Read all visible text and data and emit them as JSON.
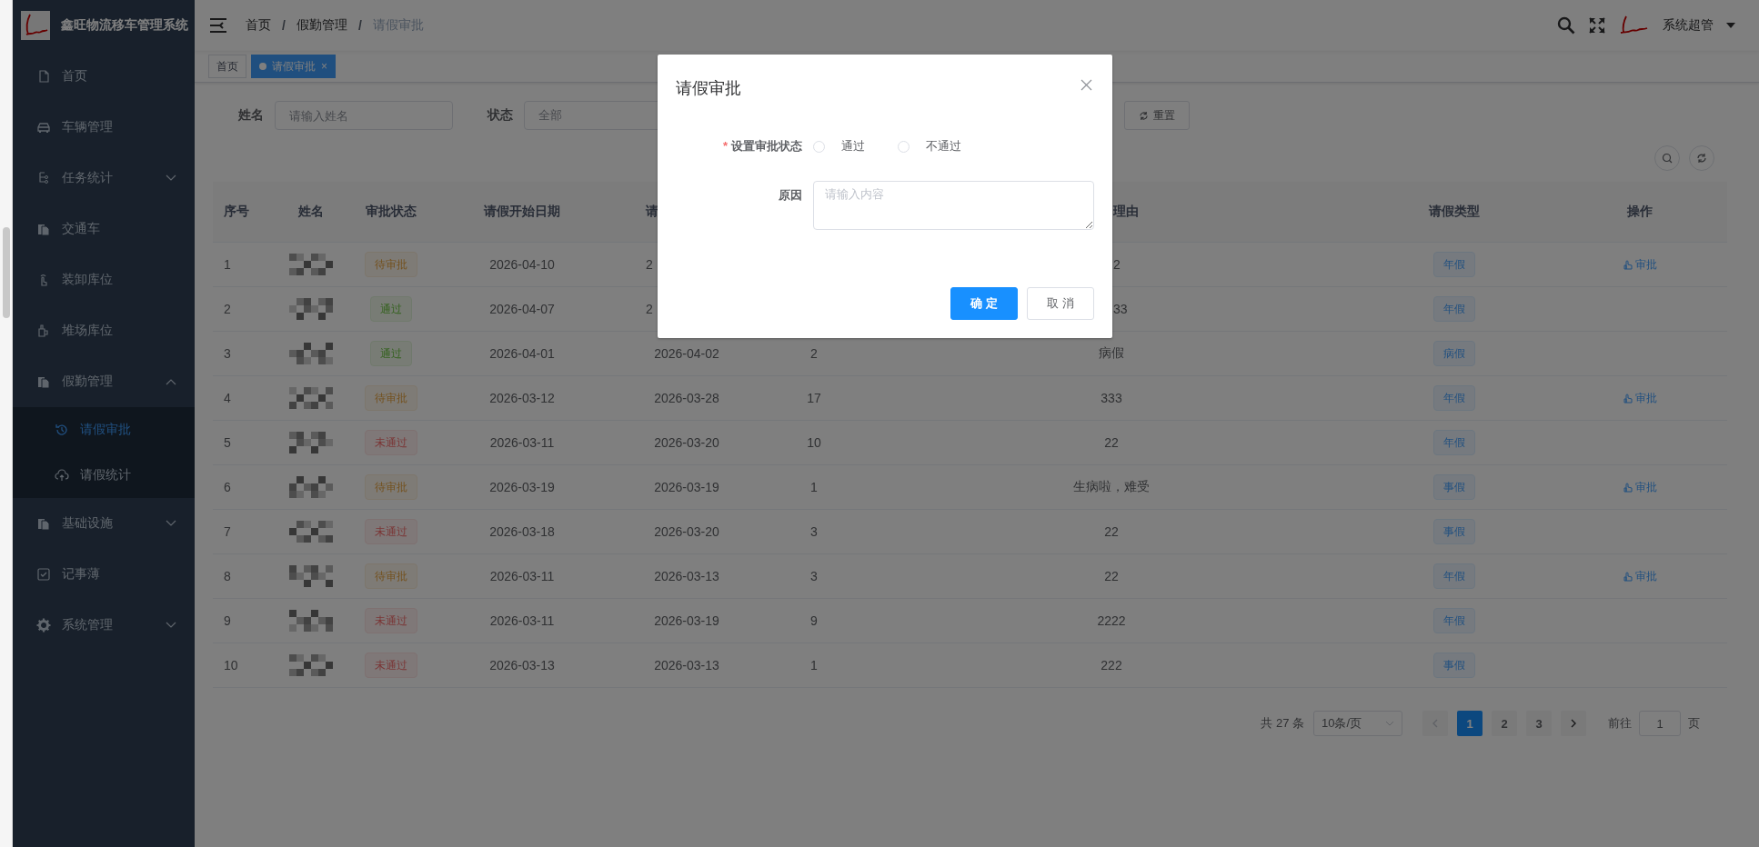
{
  "sidebar": {
    "title": "鑫旺物流移车管理系统",
    "items": [
      {
        "label": "首页",
        "kind": "link",
        "selected": false
      },
      {
        "label": "车辆管理",
        "kind": "link",
        "selected": false
      },
      {
        "label": "任务统计",
        "kind": "group",
        "expanded": false,
        "selected": false
      },
      {
        "label": "交通车",
        "kind": "link",
        "selected": false
      },
      {
        "label": "装卸库位",
        "kind": "link",
        "selected": false
      },
      {
        "label": "堆场库位",
        "kind": "link",
        "selected": false
      },
      {
        "label": "假勤管理",
        "kind": "group",
        "expanded": true,
        "selected": false,
        "children": [
          {
            "label": "请假审批",
            "selected": true
          },
          {
            "label": "请假统计",
            "selected": false
          }
        ]
      },
      {
        "label": "基础设施",
        "kind": "group",
        "expanded": false,
        "selected": false
      },
      {
        "label": "记事薄",
        "kind": "link",
        "selected": false
      },
      {
        "label": "系统管理",
        "kind": "group",
        "expanded": false,
        "selected": false
      }
    ]
  },
  "breadcrumb": {
    "separator": "/",
    "items": [
      "首页",
      "假勤管理",
      "请假审批"
    ]
  },
  "user": {
    "name": "系统超管"
  },
  "tabs": [
    {
      "label": "首页",
      "selected": false
    },
    {
      "label": "请假审批",
      "selected": true,
      "close": "×"
    }
  ],
  "filters": {
    "name": {
      "label": "姓名",
      "placeholder": "请输入姓名"
    },
    "status": {
      "label": "状态",
      "placeholder": "全部"
    },
    "reset_button": "重置"
  },
  "table": {
    "columns": [
      {
        "label": "序号"
      },
      {
        "label": "姓名"
      },
      {
        "label": "审批状态"
      },
      {
        "label": "请假开始日期"
      },
      {
        "label": "请",
        "covered": true
      },
      {
        "label": "理由",
        "covered": true
      },
      {
        "label": "请假类型"
      },
      {
        "label": "操作"
      }
    ],
    "rows": [
      {
        "no": "1",
        "kind": "pending",
        "status": "待审批",
        "start": "2026-04-10",
        "end": "2",
        "reason": "2",
        "covered": true,
        "type": "年假",
        "action": "审批"
      },
      {
        "no": "2",
        "kind": "approved",
        "status": "通过",
        "start": "2026-04-07",
        "end": "2",
        "reason": "33",
        "covered": true,
        "type": "年假"
      },
      {
        "no": "3",
        "kind": "approved",
        "status": "通过",
        "start": "2026-04-01",
        "end": "2026-04-02",
        "days": "2",
        "reason": "病假",
        "covered": false,
        "type": "病假"
      },
      {
        "no": "4",
        "kind": "pending",
        "status": "待审批",
        "start": "2026-03-12",
        "end": "2026-03-28",
        "days": "17",
        "reason": "333",
        "covered": false,
        "type": "年假",
        "action": "审批"
      },
      {
        "no": "5",
        "kind": "rejected",
        "status": "未通过",
        "start": "2026-03-11",
        "end": "2026-03-20",
        "days": "10",
        "reason": "22",
        "covered": false,
        "type": "年假"
      },
      {
        "no": "6",
        "kind": "pending",
        "status": "待审批",
        "start": "2026-03-19",
        "end": "2026-03-19",
        "days": "1",
        "reason": "生病啦，难受",
        "covered": false,
        "type": "事假",
        "action": "审批"
      },
      {
        "no": "7",
        "kind": "rejected",
        "status": "未通过",
        "start": "2026-03-18",
        "end": "2026-03-20",
        "days": "3",
        "reason": "22",
        "covered": false,
        "type": "事假"
      },
      {
        "no": "8",
        "kind": "pending",
        "status": "待审批",
        "start": "2026-03-11",
        "end": "2026-03-13",
        "days": "3",
        "reason": "22",
        "covered": false,
        "type": "年假",
        "action": "审批"
      },
      {
        "no": "9",
        "kind": "rejected",
        "status": "未通过",
        "start": "2026-03-11",
        "end": "2026-03-19",
        "days": "9",
        "reason": "2222",
        "covered": false,
        "type": "年假"
      },
      {
        "no": "10",
        "kind": "rejected",
        "status": "未通过",
        "start": "2026-03-13",
        "end": "2026-03-13",
        "days": "1",
        "reason": "222",
        "covered": false,
        "type": "事假"
      }
    ]
  },
  "pagination": {
    "total": "共 27 条",
    "page_size": "10条/页",
    "pages": [
      {
        "label": "1",
        "selected": true
      },
      {
        "label": "2",
        "selected": false
      },
      {
        "label": "3",
        "selected": false
      }
    ],
    "goto_label": "前往",
    "goto_value": "1",
    "goto_suffix": "页"
  },
  "dialog": {
    "title": "请假审批",
    "required_mark": "*",
    "status_label": "设置审批状态",
    "options": [
      {
        "label": "通过",
        "selected": false
      },
      {
        "label": "不通过",
        "selected": false
      }
    ],
    "reason_label": "原因",
    "reason_placeholder": "请输入内容",
    "confirm": "确 定",
    "cancel": "取 消"
  }
}
